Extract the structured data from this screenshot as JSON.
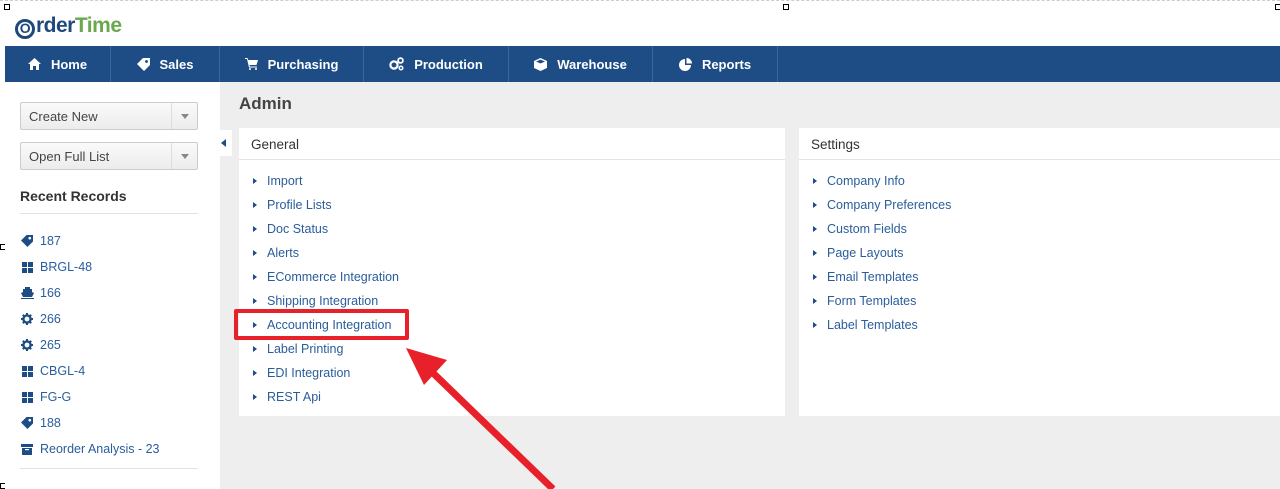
{
  "brand": {
    "o": "O",
    "rder": "rder",
    "time": "Time"
  },
  "nav": {
    "items": [
      {
        "label": "Home",
        "icon": "home-icon"
      },
      {
        "label": "Sales",
        "icon": "tag-icon"
      },
      {
        "label": "Purchasing",
        "icon": "cart-icon"
      },
      {
        "label": "Production",
        "icon": "gears-icon"
      },
      {
        "label": "Warehouse",
        "icon": "box-icon"
      },
      {
        "label": "Reports",
        "icon": "pie-chart-icon"
      }
    ]
  },
  "sidebar": {
    "create_new": "Create New",
    "open_full_list": "Open Full List",
    "recent_title": "Recent Records",
    "recent": [
      {
        "label": "187",
        "icon": "tag-icon"
      },
      {
        "label": "BRGL-48",
        "icon": "grid-icon"
      },
      {
        "label": "166",
        "icon": "ship-icon"
      },
      {
        "label": "266",
        "icon": "gear-icon"
      },
      {
        "label": "265",
        "icon": "gear-icon"
      },
      {
        "label": "CBGL-4",
        "icon": "grid-icon"
      },
      {
        "label": "FG-G",
        "icon": "grid-icon"
      },
      {
        "label": "188",
        "icon": "tag-icon"
      },
      {
        "label": "Reorder Analysis - 23",
        "icon": "archive-icon"
      }
    ]
  },
  "main": {
    "title": "Admin",
    "general": {
      "title": "General",
      "items": [
        "Import",
        "Profile Lists",
        "Doc Status",
        "Alerts",
        "ECommerce Integration",
        "Shipping Integration",
        "Accounting Integration",
        "Label Printing",
        "EDI Integration",
        "REST Api"
      ]
    },
    "settings": {
      "title": "Settings",
      "items": [
        "Company Info",
        "Company Preferences",
        "Custom Fields",
        "Page Layouts",
        "Email Templates",
        "Form Templates",
        "Label Templates"
      ]
    }
  },
  "colors": {
    "nav": "#1e4d86",
    "link": "#2a5d9c",
    "annotation": "#e8202a",
    "logo_green": "#6aa84f"
  }
}
